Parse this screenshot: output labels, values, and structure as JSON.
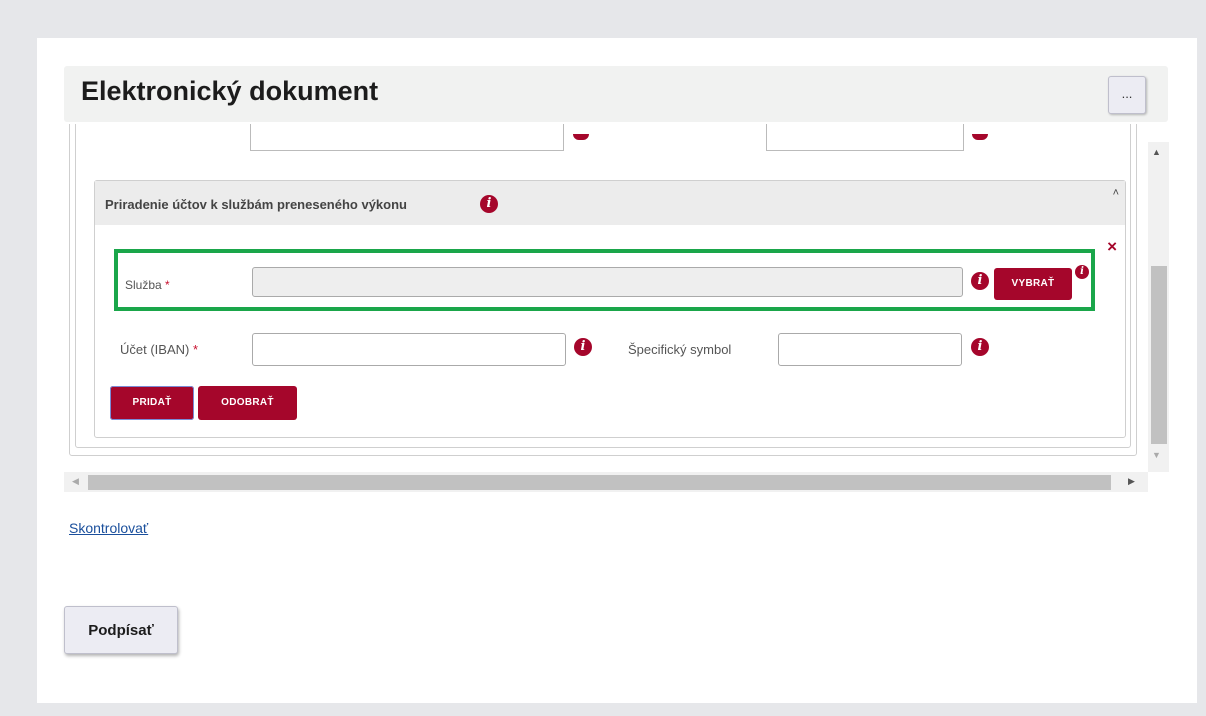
{
  "header": {
    "title": "Elektronický dokument",
    "menu_label": "..."
  },
  "section": {
    "title": "Priradenie účtov k službám preneseného výkonu",
    "close_label": "×",
    "caret": "˄"
  },
  "form": {
    "service_label": "Služba",
    "service_value": "",
    "select_button": "VYBRAŤ",
    "iban_label": "Účet (IBAN)",
    "iban_value": "",
    "symbol_label": "Špecifický symbol",
    "symbol_value": "",
    "required_mark": "*",
    "info_glyph": "i"
  },
  "actions": {
    "add": "PRIDAŤ",
    "remove": "ODOBRAŤ"
  },
  "footer": {
    "check_link": "Skontrolovať",
    "sign_button": "Podpísať"
  },
  "scroll": {
    "up": "▲",
    "down": "▼",
    "left": "◀",
    "right": "▶"
  },
  "colors": {
    "accent": "#a5062b",
    "highlight": "#1aa64a",
    "link": "#1a4f9c"
  }
}
